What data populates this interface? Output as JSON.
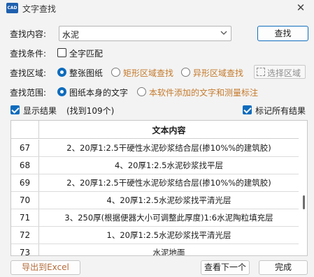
{
  "window": {
    "app_icon_text": "CAD",
    "title": "文字查找",
    "close_glyph": "✕"
  },
  "search": {
    "label": "查找内容:",
    "value": "水泥",
    "button": "查找"
  },
  "condition": {
    "label": "查找条件:",
    "whole_word": "全字匹配",
    "whole_word_checked": false
  },
  "area": {
    "label": "查找区域:",
    "options": [
      "整张图纸",
      "矩形区域查找",
      "异形区域查找"
    ],
    "selected": 0,
    "select_button": "选择区域"
  },
  "scope": {
    "label": "查找范围:",
    "options": [
      "图纸本身的文字",
      "本软件添加的文字和测量标注"
    ],
    "selected": 0
  },
  "results": {
    "show_label": "显示结果",
    "show_checked": true,
    "count_text": "(找到109个)",
    "mark_all_label": "标记所有结果",
    "mark_all_checked": true
  },
  "table": {
    "header_text": "文本内容",
    "rows": [
      {
        "idx": "67",
        "text": "2、20厚1:2.5干硬性水泥砂浆结合层(掺10%%的建筑胶)"
      },
      {
        "idx": "68",
        "text": "4、20厚1:2.5水泥砂浆找平层"
      },
      {
        "idx": "69",
        "text": "2、20厚1:2.5干硬性水泥砂浆结合层(掺10%%的建筑胶)"
      },
      {
        "idx": "70",
        "text": "4、20厚1:2.5水泥砂浆找平清光层"
      },
      {
        "idx": "71",
        "text": "3、250厚(根据便器大小可调整此厚度)1:6水泥陶粒填充层"
      },
      {
        "idx": "72",
        "text": "1、20厚1:2.5水泥砂浆找平清光层"
      },
      {
        "idx": "73",
        "text": "水泥地面"
      }
    ]
  },
  "footer": {
    "export": "导出到Excel",
    "next": "查看下一个",
    "done": "完成"
  },
  "colors": {
    "accent": "#0f6cbd",
    "inactive_option": "#c47a2c"
  },
  "icons": {
    "dropdown": "chevron-down-icon",
    "select_area": "dashed-rect-icon"
  }
}
